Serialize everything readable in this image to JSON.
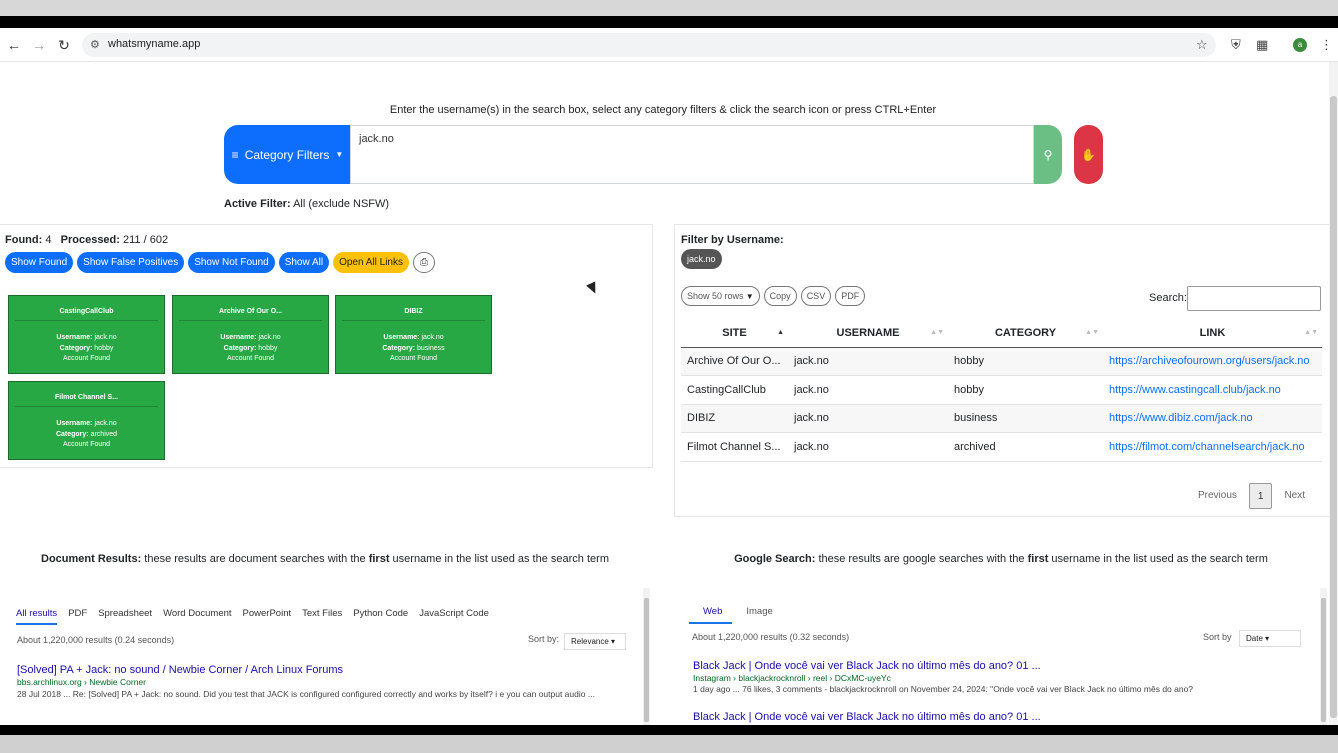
{
  "browser": {
    "url": "whatsmyname.app",
    "back_icon": "arrow-left-icon",
    "forward_icon": "arrow-right-icon",
    "reload_icon": "reload-icon",
    "profile_initial": "a"
  },
  "search": {
    "instructions": "Enter the username(s) in the search box, select any category filters & click the search icon or press CTRL+Enter",
    "category_button": "Category Filters",
    "query": "jack.no",
    "active_filter_label": "Active Filter:",
    "active_filter_value": "All (exclude NSFW)"
  },
  "status": {
    "found_label": "Found:",
    "found_count": "4",
    "processed_label": "Processed:",
    "processed_value": "211 / 602"
  },
  "actions": {
    "show_found": "Show Found",
    "show_false_positives": "Show False Positives",
    "show_not_found": "Show Not Found",
    "show_all": "Show All",
    "open_all_links": "Open All Links"
  },
  "cards": [
    {
      "title": "CastingCallClub",
      "username_label": "Username:",
      "username": "jack.no",
      "category_label": "Category:",
      "category": "hobby",
      "status": "Account Found"
    },
    {
      "title": "Archive Of Our O...",
      "username_label": "Username:",
      "username": "jack.no",
      "category_label": "Category:",
      "category": "hobby",
      "status": "Account Found"
    },
    {
      "title": "DIBIZ",
      "username_label": "Username:",
      "username": "jack.no",
      "category_label": "Category:",
      "category": "business",
      "status": "Account Found"
    },
    {
      "title": "Filmot Channel S...",
      "username_label": "Username:",
      "username": "jack.no",
      "category_label": "Category:",
      "category": "archived",
      "status": "Account Found"
    }
  ],
  "filter": {
    "label": "Filter by Username:",
    "chip": "jack.no"
  },
  "table_tools": {
    "show_rows": "Show 50 rows",
    "copy": "Copy",
    "csv": "CSV",
    "pdf": "PDF",
    "search_label": "Search:"
  },
  "table": {
    "headers": [
      "SITE",
      "USERNAME",
      "CATEGORY",
      "LINK"
    ],
    "rows": [
      [
        "Archive Of Our O...",
        "jack.no",
        "hobby",
        "https://archiveofourown.org/users/jack.no"
      ],
      [
        "CastingCallClub",
        "jack.no",
        "hobby",
        "https://www.castingcall.club/jack.no"
      ],
      [
        "DIBIZ",
        "jack.no",
        "business",
        "https://www.dibiz.com/jack.no"
      ],
      [
        "Filmot Channel S...",
        "jack.no",
        "archived",
        "https://filmot.com/channelsearch/jack.no"
      ]
    ]
  },
  "pagination": {
    "previous": "Previous",
    "current": "1",
    "next": "Next"
  },
  "documents": {
    "heading_bold": "Document Results:",
    "heading_a": " these results are document searches with the ",
    "heading_first": "first",
    "heading_b": " username in the list used as the search term",
    "tabs": [
      "All results",
      "PDF",
      "Spreadsheet",
      "Word Document",
      "PowerPoint",
      "Text Files",
      "Python Code",
      "JavaScript Code"
    ],
    "stats": "About 1,220,000 results (0.24 seconds)",
    "sort_label": "Sort by:",
    "sort_value": "Relevance",
    "result_title": "[Solved] PA + Jack: no sound / Newbie Corner / Arch Linux Forums",
    "result_url": "bbs.archlinux.org › Newbie Corner",
    "result_snippet": "28 Jul 2018 ... Re: [Solved] PA + Jack: no sound. Did you test that JACK is configured configured correctly and works by itself? i e you can output audio ..."
  },
  "google": {
    "heading_bold": "Google Search:",
    "heading_a": " these results are google searches with the ",
    "heading_first": "first",
    "heading_b": " username in the list used as the search term",
    "tabs": [
      "Web",
      "Image"
    ],
    "stats": "About 1,220,000 results (0.32 seconds)",
    "sort_label": "Sort by",
    "sort_value": "Date",
    "result1_title": "Black Jack | Onde você vai ver Black Jack no último mês do ano? 01 ...",
    "result1_url": "Instagram › blackjackrocknroll › reel › DCxMC-uyeYc",
    "result1_snippet": "1 day ago ... 76 likes, 3 comments - blackjackrocknroll on November 24, 2024: \"Onde você vai ver Black Jack no último mês do ano?",
    "result2_title": "Black Jack | Onde você vai ver Black Jack no último mês do ano? 01 ..."
  }
}
